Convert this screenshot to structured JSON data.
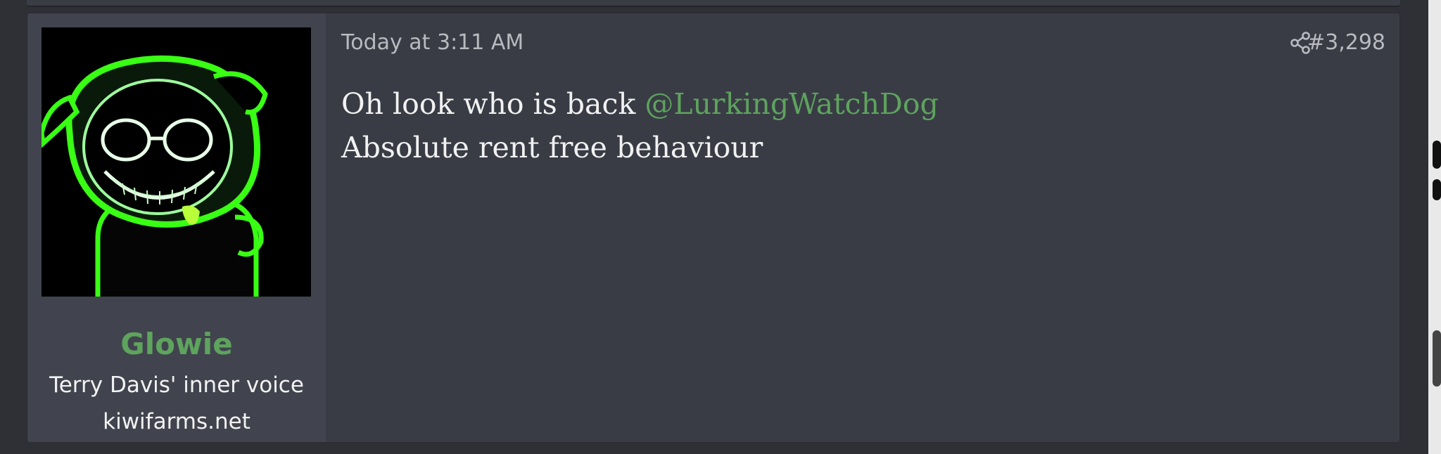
{
  "post": {
    "date": "Today at 3:11 AM",
    "number": "#3,298",
    "body": {
      "line1_text": "Oh look who is back ",
      "mention": "@LurkingWatchDog",
      "line2_text": "Absolute rent free behaviour"
    }
  },
  "user": {
    "name": "Glowie",
    "title": "Terry Davis' inner voice",
    "banner": "kiwifarms.net"
  },
  "icons": {
    "share": "share-icon"
  },
  "colors": {
    "username": "#5ea35e",
    "mention": "#5ea35e",
    "post_bg": "#393c45",
    "user_col_bg": "#41444e",
    "page_bg": "#2e3036",
    "avatar_glow": "#39ff14"
  }
}
